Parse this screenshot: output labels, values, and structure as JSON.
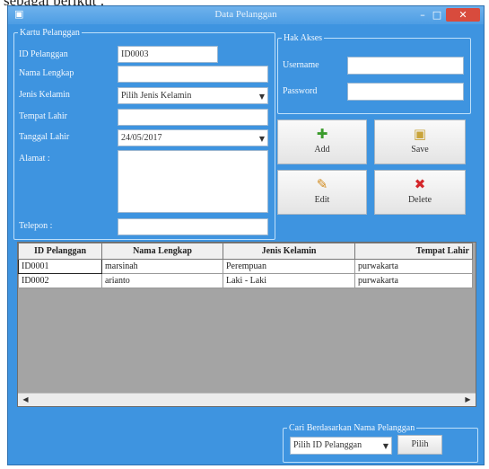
{
  "document": {
    "intro_text": "sebagai berikut :"
  },
  "window": {
    "title": "Data Pelanggan",
    "minimize_glyph": "–",
    "maximize_glyph": "□",
    "close_glyph": "✕"
  },
  "customer_form": {
    "legend": "Kartu Pelanggan",
    "labels": {
      "id": "ID Pelanggan",
      "name": "Nama Lengkap",
      "gender": "Jenis Kelamin",
      "birthplace": "Tempat Lahir",
      "birthdate": "Tanggal Lahir",
      "address": "Alamat :",
      "phone": "Telepon :"
    },
    "values": {
      "id": "ID0003",
      "name": "",
      "gender": "Pilih Jenis Kelamin",
      "birthplace": "",
      "birthdate": "24/05/2017",
      "address": "",
      "phone": ""
    }
  },
  "login_panel": {
    "legend": "Hak Akses",
    "labels": {
      "username": "Username",
      "password": "Password"
    },
    "values": {
      "username": "",
      "password": ""
    }
  },
  "actions": {
    "add": {
      "label": "Add",
      "icon": "add-icon"
    },
    "save": {
      "label": "Save",
      "icon": "save-icon"
    },
    "edit": {
      "label": "Edit",
      "icon": "edit-icon"
    },
    "delete": {
      "label": "Delete",
      "icon": "delete-icon"
    }
  },
  "grid": {
    "columns": [
      "ID Pelanggan",
      "Nama Lengkap",
      "Jenis Kelamin",
      "Tempat Lahir"
    ],
    "rows": [
      [
        "ID0001",
        "marsinah",
        "Perempuan",
        "purwakarta"
      ],
      [
        "ID0002",
        "arianto",
        "Laki - Laki",
        "purwakarta"
      ]
    ]
  },
  "search_panel": {
    "legend": "Cari Berdasarkan Nama Pelanggan",
    "select_value": "Pilih ID Pelanggan",
    "button_label": "Pilih"
  }
}
